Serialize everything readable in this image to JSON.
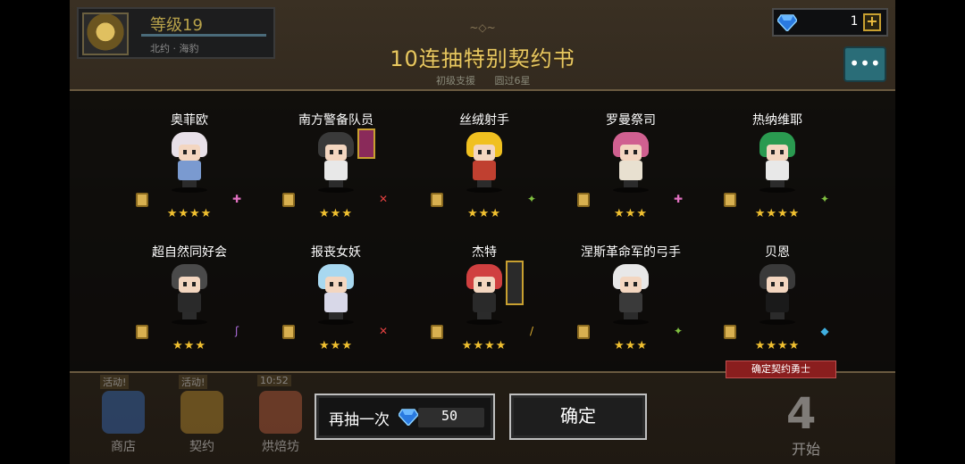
{
  "player": {
    "level": "等级19",
    "subtitle": "北约 · 海豹"
  },
  "currency": {
    "gems": "1",
    "plus": "+"
  },
  "banner": {
    "title": "10连抽特别契约书",
    "subs": [
      "初级支援",
      "圆过6星"
    ]
  },
  "characters": [
    {
      "name": "奥菲欧",
      "stars": "★★★★",
      "class_icon": "staff-icon",
      "hair": "#e8e0e8",
      "body": "#7a9ad0",
      "cls_color": "#e070c0",
      "cls_glyph": "✚"
    },
    {
      "name": "南方警备队员",
      "stars": "★★★",
      "class_icon": "sword-icon",
      "hair": "#3a3a3a",
      "body": "#e8e8e8",
      "cls_color": "#e04040",
      "cls_glyph": "✕"
    },
    {
      "name": "丝绒射手",
      "stars": "★★★",
      "class_icon": "bow-icon",
      "hair": "#f0c020",
      "body": "#c04030",
      "cls_color": "#80c040",
      "cls_glyph": "✦"
    },
    {
      "name": "罗曼祭司",
      "stars": "★★★",
      "class_icon": "staff-icon",
      "hair": "#d06090",
      "body": "#e8e0d0",
      "cls_color": "#e070c0",
      "cls_glyph": "✚"
    },
    {
      "name": "热纳维耶",
      "stars": "★★★★",
      "class_icon": "bow-icon",
      "hair": "#2a9a50",
      "body": "#e8e8e8",
      "cls_color": "#80c040",
      "cls_glyph": "✦"
    },
    {
      "name": "超自然同好会",
      "stars": "★★★",
      "class_icon": "wand-icon",
      "hair": "#4a4a4a",
      "body": "#2a2a2a",
      "cls_color": "#b070e0",
      "cls_glyph": "ʃ"
    },
    {
      "name": "报丧女妖",
      "stars": "★★★",
      "class_icon": "sword-icon",
      "hair": "#a8d8f0",
      "body": "#d8d8e8",
      "cls_color": "#e04040",
      "cls_glyph": "✕"
    },
    {
      "name": "杰特",
      "stars": "★★★★",
      "class_icon": "dagger-icon",
      "hair": "#d04040",
      "body": "#2a2a2a",
      "cls_color": "#e0b030",
      "cls_glyph": "/"
    },
    {
      "name": "涅斯革命军的弓手",
      "stars": "★★★",
      "class_icon": "bow-icon",
      "hair": "#e8e8e8",
      "body": "#3a3a3a",
      "cls_color": "#80c040",
      "cls_glyph": "✦"
    },
    {
      "name": "贝恩",
      "stars": "★★★★",
      "class_icon": "gem-icon",
      "hair": "#3a3a3a",
      "body": "#1a1a1a",
      "cls_color": "#40b0e0",
      "cls_glyph": "◆"
    }
  ],
  "confirm_tag": "确定契约勇士",
  "nav": [
    {
      "label": "商店",
      "tag": "活动!",
      "color": "#3a70c0"
    },
    {
      "label": "契约",
      "tag": "活动!",
      "color": "#c09030"
    },
    {
      "label": "烘焙坊",
      "tag": "10:52",
      "color": "#c06040"
    }
  ],
  "retry": {
    "label": "再抽一次",
    "cost": "50"
  },
  "confirm": {
    "label": "确定"
  },
  "start": {
    "label": "开始",
    "num": "4"
  }
}
